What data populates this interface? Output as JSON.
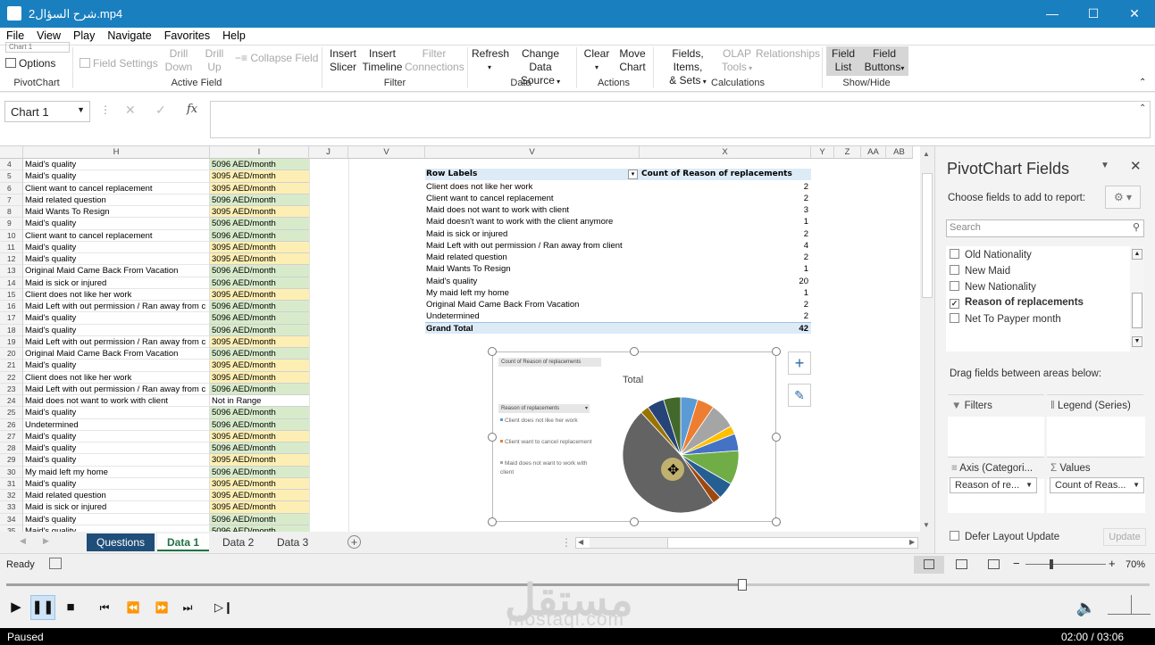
{
  "window": {
    "title": "شرح السؤال2.mp4"
  },
  "menu": [
    "File",
    "View",
    "Play",
    "Navigate",
    "Favorites",
    "Help"
  ],
  "ribbon": {
    "namebox_top": "Chart 1",
    "options": "Options",
    "field_settings": "Field Settings",
    "drill_down": [
      "Drill",
      "Down"
    ],
    "drill_up": [
      "Drill",
      "Up"
    ],
    "collapse_field": "Collapse Field",
    "insert_slicer": [
      "Insert",
      "Slicer"
    ],
    "insert_timeline": [
      "Insert",
      "Timeline"
    ],
    "filter_connections": [
      "Filter",
      "Connections"
    ],
    "refresh": [
      "Refresh",
      ""
    ],
    "change_data_source": [
      "Change Data",
      "Source"
    ],
    "clear": [
      "Clear",
      ""
    ],
    "move_chart": [
      "Move",
      "Chart"
    ],
    "fields_items": [
      "Fields, Items,",
      "& Sets"
    ],
    "olap_tools": [
      "OLAP",
      "Tools"
    ],
    "relationships": "Relationships",
    "field_list": [
      "Field",
      "List"
    ],
    "field_buttons": [
      "Field",
      "Buttons"
    ],
    "groups": [
      "PivotChart",
      "Active Field",
      "Filter",
      "Data",
      "Actions",
      "Calculations",
      "Show/Hide"
    ]
  },
  "formula": {
    "namebox": "Chart 1",
    "fx": "fx",
    "value": ""
  },
  "columns": {
    "H": "H",
    "I": "I",
    "J": "J",
    "V1": "V",
    "V2": "V",
    "X": "X",
    "Y": "Y",
    "Z": "Z",
    "AA": "AA",
    "AB": "AB"
  },
  "rows": [
    {
      "n": "4",
      "h": "Maid's quality",
      "i": "5096 AED/month",
      "c": "g"
    },
    {
      "n": "5",
      "h": "Maid's quality",
      "i": "3095 AED/month",
      "c": "y"
    },
    {
      "n": "6",
      "h": "Client want to cancel replacement",
      "i": "3095 AED/month",
      "c": "y"
    },
    {
      "n": "7",
      "h": "Maid related question",
      "i": "5096 AED/month",
      "c": "g"
    },
    {
      "n": "8",
      "h": "Maid Wants To Resign",
      "i": "3095 AED/month",
      "c": "y"
    },
    {
      "n": "9",
      "h": "Maid's quality",
      "i": "5096 AED/month",
      "c": "g"
    },
    {
      "n": "10",
      "h": "Client want to cancel replacement",
      "i": "5096 AED/month",
      "c": "g"
    },
    {
      "n": "11",
      "h": "Maid's quality",
      "i": "3095 AED/month",
      "c": "y"
    },
    {
      "n": "12",
      "h": "Maid's quality",
      "i": "3095 AED/month",
      "c": "y"
    },
    {
      "n": "13",
      "h": "Original Maid Came Back From Vacation",
      "i": "5096 AED/month",
      "c": "g"
    },
    {
      "n": "14",
      "h": "Maid is sick or injured",
      "i": "5096 AED/month",
      "c": "g"
    },
    {
      "n": "15",
      "h": "Client does not like her work",
      "i": "3095 AED/month",
      "c": "y"
    },
    {
      "n": "16",
      "h": "Maid Left with out permission / Ran away from c",
      "i": "5096 AED/month",
      "c": "g"
    },
    {
      "n": "17",
      "h": "Maid's quality",
      "i": "5096 AED/month",
      "c": "g"
    },
    {
      "n": "18",
      "h": "Maid's quality",
      "i": "5096 AED/month",
      "c": "g"
    },
    {
      "n": "19",
      "h": "Maid Left with out permission / Ran away from c",
      "i": "3095 AED/month",
      "c": "y"
    },
    {
      "n": "20",
      "h": "Original Maid Came Back From Vacation",
      "i": "5096 AED/month",
      "c": "g"
    },
    {
      "n": "21",
      "h": "Maid's quality",
      "i": "3095 AED/month",
      "c": "y"
    },
    {
      "n": "22",
      "h": "Client does not like her work",
      "i": "3095 AED/month",
      "c": "y"
    },
    {
      "n": "23",
      "h": "Maid Left with out permission / Ran away from c",
      "i": "5096 AED/month",
      "c": "g"
    },
    {
      "n": "24",
      "h": "Maid does not want to work with client",
      "i": "Not in Range",
      "c": "w"
    },
    {
      "n": "25",
      "h": "Maid's quality",
      "i": "5096 AED/month",
      "c": "g"
    },
    {
      "n": "26",
      "h": "Undetermined",
      "i": "5096 AED/month",
      "c": "g"
    },
    {
      "n": "27",
      "h": "Maid's quality",
      "i": "3095 AED/month",
      "c": "y"
    },
    {
      "n": "28",
      "h": "Maid's quality",
      "i": "5096 AED/month",
      "c": "g"
    },
    {
      "n": "29",
      "h": "Maid's quality",
      "i": "3095 AED/month",
      "c": "y"
    },
    {
      "n": "30",
      "h": "My maid left my home",
      "i": "5096 AED/month",
      "c": "g"
    },
    {
      "n": "31",
      "h": "Maid's quality",
      "i": "3095 AED/month",
      "c": "y"
    },
    {
      "n": "32",
      "h": "Maid related question",
      "i": "3095 AED/month",
      "c": "y"
    },
    {
      "n": "33",
      "h": "Maid is sick or injured",
      "i": "3095 AED/month",
      "c": "y"
    },
    {
      "n": "34",
      "h": "Maid's quality",
      "i": "5096 AED/month",
      "c": "g"
    },
    {
      "n": "35",
      "h": "Maid's quality",
      "i": "5096 AED/month",
      "c": "g"
    }
  ],
  "pivot": {
    "header_label": "Row Labels",
    "header_value": "Count of Reason of replacements",
    "rows": [
      {
        "label": "Client does not like her work",
        "value": "2"
      },
      {
        "label": "Client want to cancel replacement",
        "value": "2"
      },
      {
        "label": "Maid does not want to work with client",
        "value": "3"
      },
      {
        "label": "Maid doesn't want to work with the client anymore",
        "value": "1"
      },
      {
        "label": "Maid is sick or injured",
        "value": "2"
      },
      {
        "label": "Maid Left with out permission / Ran away from client",
        "value": "4"
      },
      {
        "label": "Maid related question",
        "value": "2"
      },
      {
        "label": "Maid Wants To Resign",
        "value": "1"
      },
      {
        "label": "Maid's quality",
        "value": "20"
      },
      {
        "label": "My maid left my home",
        "value": "1"
      },
      {
        "label": "Original Maid Came Back From Vacation",
        "value": "2"
      },
      {
        "label": "Undetermined",
        "value": "2"
      }
    ],
    "total_label": "Grand Total",
    "total_value": "42"
  },
  "chart_data": {
    "type": "pie",
    "title": "Total",
    "field_button": "Count of Reason of replacements",
    "axis_button": "Reason of replacements",
    "categories": [
      "Client does not like her work",
      "Client want to cancel replacement",
      "Maid does not want to work with client",
      "Maid doesn't want to work with the client anymore",
      "Maid is sick or injured",
      "Maid Left with out permission / Ran away from client",
      "Maid related question",
      "Maid Wants To Resign",
      "Maid's quality",
      "My maid left my home",
      "Original Maid Came Back From Vacation",
      "Undetermined"
    ],
    "values": [
      2,
      2,
      3,
      1,
      2,
      4,
      2,
      1,
      20,
      1,
      2,
      2
    ],
    "colors": [
      "#5b9bd5",
      "#ed7d31",
      "#a5a5a5",
      "#ffc000",
      "#4472c4",
      "#70ad47",
      "#255e91",
      "#9e480e",
      "#636363",
      "#997300",
      "#264478",
      "#43682b"
    ],
    "legend": [
      "Client does not like her work",
      "Client want to cancel replacement",
      "Maid does not want to work with client"
    ]
  },
  "panel": {
    "title": "PivotChart Fields",
    "subtitle": "Choose fields to add to report:",
    "search_placeholder": "Search",
    "fields": [
      {
        "label": "Old Nationality",
        "checked": false
      },
      {
        "label": "New Maid",
        "checked": false
      },
      {
        "label": "New Nationality",
        "checked": false
      },
      {
        "label": "Reason of replacements",
        "checked": true
      },
      {
        "label": "Net To Payper month",
        "checked": false
      }
    ],
    "drag_label": "Drag fields between areas below:",
    "areas": {
      "filters": "Filters",
      "legend": "Legend (Series)",
      "axis": "Axis (Categori...",
      "values": "Values"
    },
    "axis_field": "Reason of re...",
    "values_field": "Count of Reas...",
    "defer": "Defer Layout Update",
    "update": "Update"
  },
  "sheets": [
    "Questions",
    "Data 1",
    "Data 2",
    "Data 3"
  ],
  "status": {
    "ready": "Ready",
    "zoom": "70%"
  },
  "player": {
    "status": "Paused",
    "time": "02:00 / 03:06",
    "watermark_ar": "مستقل",
    "watermark_en": "mostaql.com"
  }
}
